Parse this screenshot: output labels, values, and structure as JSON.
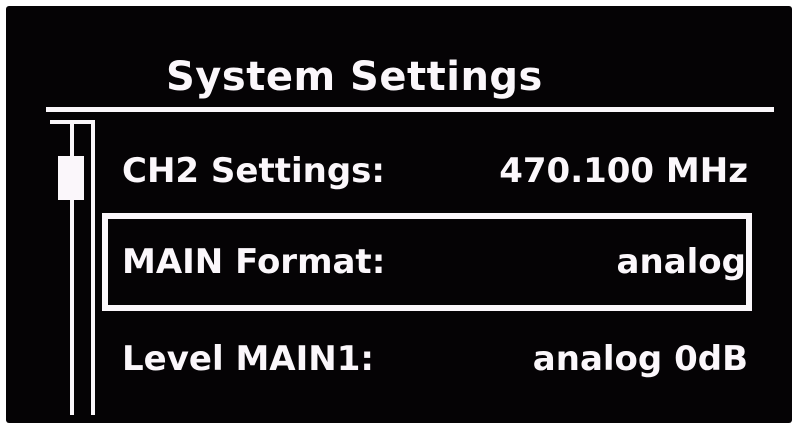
{
  "screen": {
    "title": "System Settings",
    "scrollbar": {
      "position": 0.0,
      "visible_fraction": 0.15
    },
    "menu_items": [
      {
        "label": "CH2 Settings:",
        "value": "470.100 MHz",
        "selected": false
      },
      {
        "label": "MAIN Format:",
        "value": "analog",
        "selected": true
      },
      {
        "label": "Level MAIN1:",
        "value": "analog 0dB",
        "selected": false
      }
    ]
  },
  "colors": {
    "background": "#050305",
    "foreground": "#fbf7fb"
  }
}
